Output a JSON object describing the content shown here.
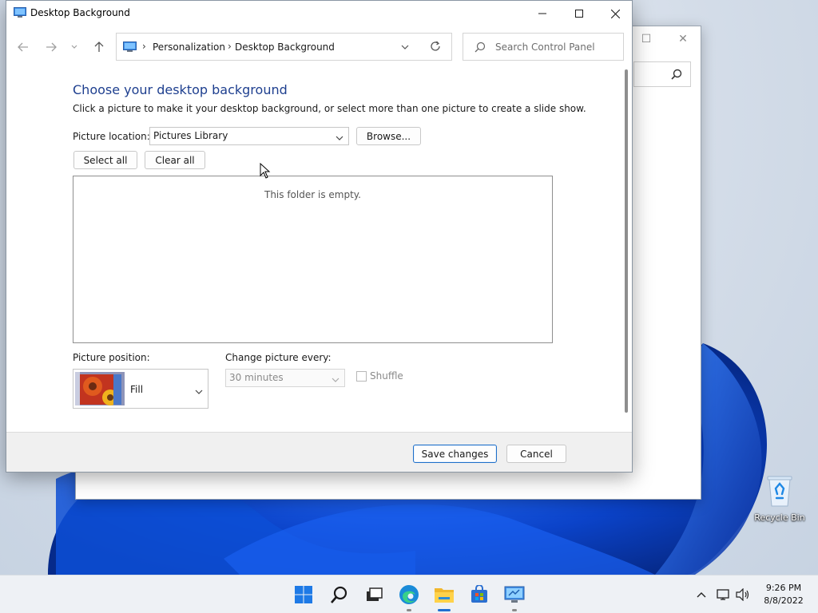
{
  "window": {
    "title": "Desktop Background",
    "minimize": "Minimize",
    "maximize": "Maximize",
    "close": "Close"
  },
  "nav": {
    "back_icon": "arrow-left-icon",
    "forward_icon": "arrow-right-icon",
    "recent_icon": "chevron-down-icon",
    "up_icon": "arrow-up-icon",
    "breadcrumb": [
      "Personalization",
      "Desktop Background"
    ],
    "search_placeholder": "Search Control Panel"
  },
  "main": {
    "heading": "Choose your desktop background",
    "description": "Click a picture to make it your desktop background, or select more than one picture to create a slide show.",
    "picture_location_label": "Picture location:",
    "picture_location_value": "Pictures Library",
    "browse_label": "Browse...",
    "select_all_label": "Select all",
    "clear_all_label": "Clear all",
    "empty_message": "This folder is empty.",
    "picture_position_label": "Picture position:",
    "picture_position_value": "Fill",
    "change_every_label": "Change picture every:",
    "change_every_value": "30 minutes",
    "shuffle_label": "Shuffle",
    "shuffle_checked": false
  },
  "footer": {
    "save_label": "Save changes",
    "cancel_label": "Cancel"
  },
  "desktop": {
    "recycle_bin_label": "Recycle Bin"
  },
  "taskbar": {
    "apps": [
      "start-icon",
      "search-icon",
      "task-view-icon",
      "edge-icon",
      "file-explorer-icon",
      "store-icon",
      "control-panel-icon"
    ],
    "time": "9:26 PM",
    "date": "8/8/2022"
  },
  "colors": {
    "heading": "#1e3f8f",
    "accent": "#1f6fd1",
    "wallpaper_blue": "#0a3fb8"
  }
}
